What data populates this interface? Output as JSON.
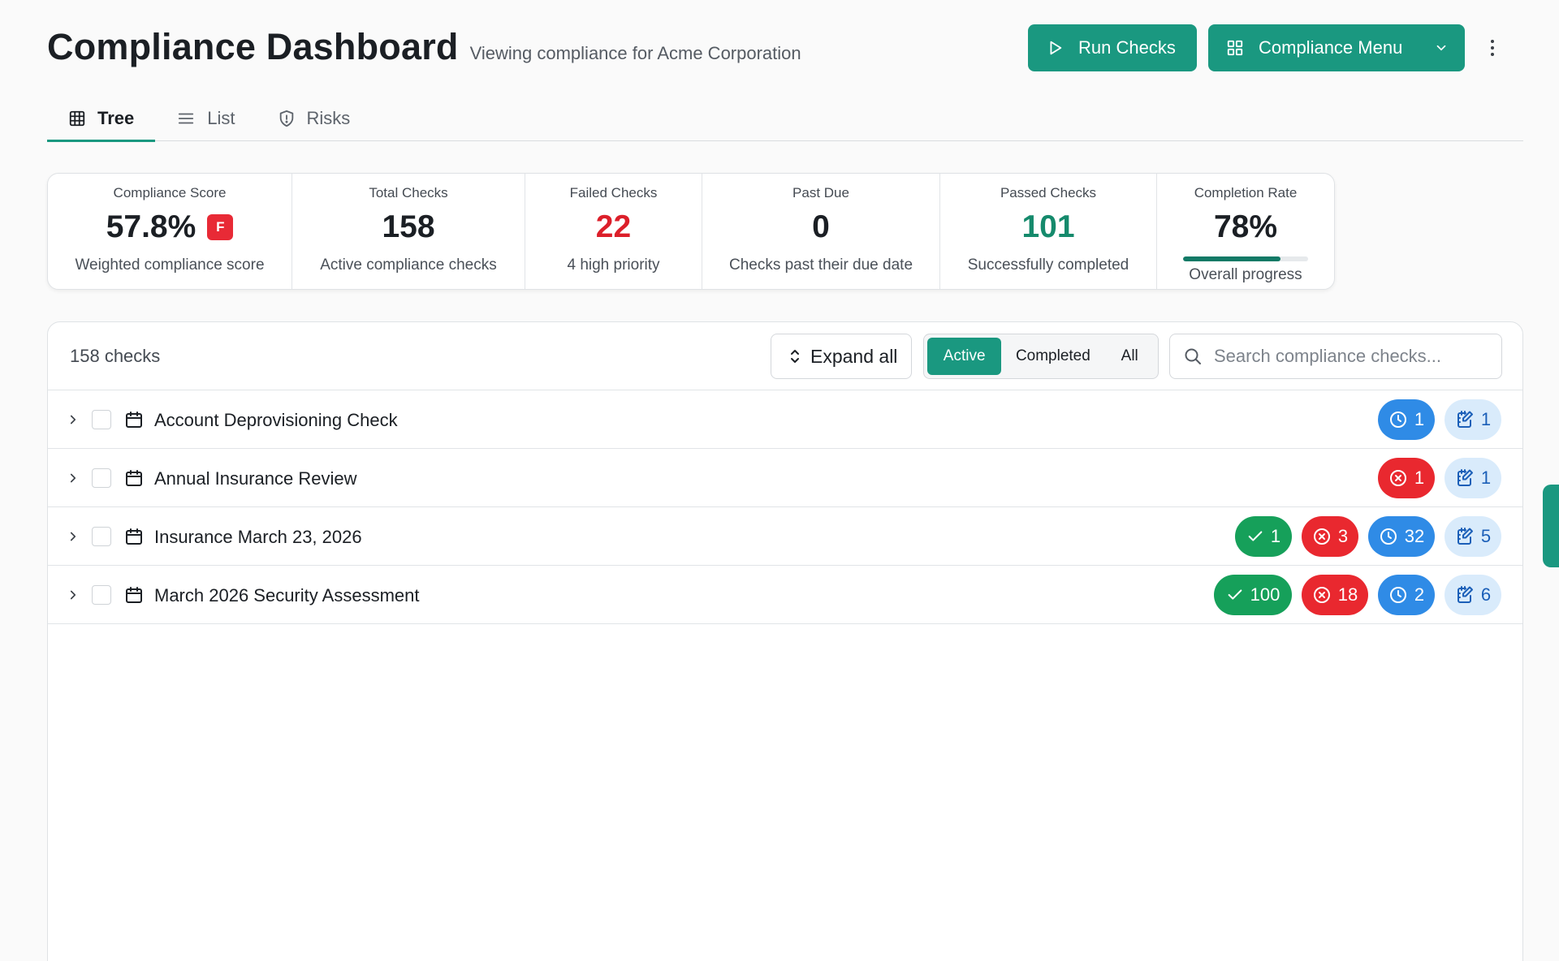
{
  "header": {
    "title": "Compliance Dashboard",
    "subtitle": "Viewing compliance for Acme Corporation",
    "run_label": "Run Checks",
    "menu_label": "Compliance Menu"
  },
  "tabs": [
    {
      "label": "Tree",
      "icon": "grid-icon",
      "active": true
    },
    {
      "label": "List",
      "icon": "list-icon",
      "active": false
    },
    {
      "label": "Risks",
      "icon": "shield-icon",
      "active": false
    }
  ],
  "stats": {
    "score": {
      "label": "Compliance Score",
      "value": "57.8%",
      "grade": "F",
      "desc": "Weighted compliance score"
    },
    "total": {
      "label": "Total Checks",
      "value": "158",
      "desc": "Active compliance checks"
    },
    "failed": {
      "label": "Failed Checks",
      "value": "22",
      "desc": "4 high priority"
    },
    "pastdue": {
      "label": "Past Due",
      "value": "0",
      "desc": "Checks past their due date"
    },
    "passed": {
      "label": "Passed Checks",
      "value": "101",
      "desc": "Successfully completed"
    },
    "completion": {
      "label": "Completion Rate",
      "value": "78%",
      "progress": 0.78,
      "desc": "Overall progress"
    }
  },
  "colors": {
    "accent": "#1a9880",
    "danger": "#e9282f",
    "success": "#16a05a",
    "info": "#2f8be6"
  },
  "toolbar": {
    "count": "158 checks",
    "expand_label": "Expand all",
    "filters": [
      "Active",
      "Completed",
      "All"
    ],
    "active_filter": "Active",
    "search_placeholder": "Search compliance checks..."
  },
  "rows": [
    {
      "name": "Account Deprovisioning Check",
      "pending": "1",
      "notes": "1"
    },
    {
      "name": "Annual Insurance Review",
      "failed": "1",
      "notes": "1"
    },
    {
      "name": "Insurance March 23, 2026",
      "passed": "1",
      "failed": "3",
      "pending": "32",
      "notes": "5"
    },
    {
      "name": "March 2026 Security Assessment",
      "passed": "100",
      "failed": "18",
      "pending": "2",
      "notes": "6"
    }
  ]
}
